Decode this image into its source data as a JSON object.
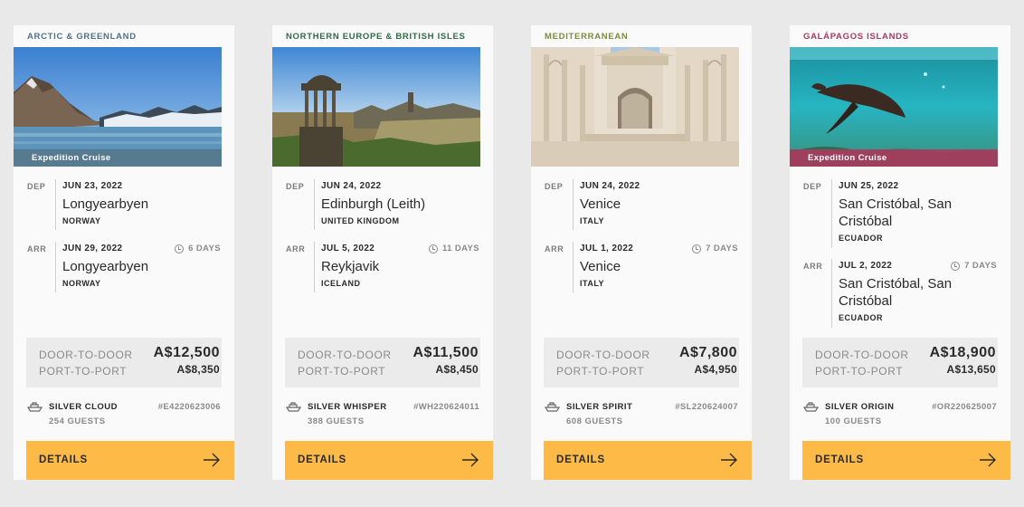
{
  "cards": [
    {
      "region": "ARCTIC & GREENLAND",
      "region_color": "#4f7286",
      "image": "arctic-mountains-fjord",
      "badge": "Expedition Cruise",
      "badge_color": "#4f7286",
      "dep": {
        "code": "DEP",
        "date": "JUN 23, 2022",
        "city": "Longyearbyen",
        "country": "NORWAY"
      },
      "arr": {
        "code": "ARR",
        "date": "JUN 29, 2022",
        "city": "Longyearbyen",
        "country": "NORWAY"
      },
      "duration": "6 DAYS",
      "door_label": "DOOR-TO-DOOR",
      "door_price": "A$12,500",
      "port_label": "PORT-TO-PORT",
      "port_price": "A$8,350",
      "ship_name": "SILVER CLOUD",
      "guests": "254 GUESTS",
      "voyage_code": "#E4220623006",
      "details_label": "DETAILS"
    },
    {
      "region": "NORTHERN EUROPE & BRITISH ISLES",
      "region_color": "#2f6b46",
      "image": "edinburgh-monument-sunset",
      "badge": "",
      "badge_color": "",
      "dep": {
        "code": "DEP",
        "date": "JUN 24, 2022",
        "city": "Edinburgh (Leith)",
        "country": "UNITED KINGDOM"
      },
      "arr": {
        "code": "ARR",
        "date": "JUL 5, 2022",
        "city": "Reykjavik",
        "country": "ICELAND"
      },
      "duration": "11 DAYS",
      "door_label": "DOOR-TO-DOOR",
      "door_price": "A$11,500",
      "port_label": "PORT-TO-PORT",
      "port_price": "A$8,450",
      "ship_name": "SILVER WHISPER",
      "guests": "388 GUESTS",
      "voyage_code": "#WH220624011",
      "details_label": "DETAILS"
    },
    {
      "region": "MEDITERRANEAN",
      "region_color": "#7e8a3c",
      "image": "split-diocletian-palace",
      "badge": "",
      "badge_color": "",
      "dep": {
        "code": "DEP",
        "date": "JUN 24, 2022",
        "city": "Venice",
        "country": "ITALY"
      },
      "arr": {
        "code": "ARR",
        "date": "JUL 1, 2022",
        "city": "Venice",
        "country": "ITALY"
      },
      "duration": "7 DAYS",
      "door_label": "DOOR-TO-DOOR",
      "door_price": "A$7,800",
      "port_label": "PORT-TO-PORT",
      "port_price": "A$4,950",
      "ship_name": "SILVER SPIRIT",
      "guests": "608 GUESTS",
      "voyage_code": "#SL220624007",
      "details_label": "DETAILS"
    },
    {
      "region": "GALÁPAGOS ISLANDS",
      "region_color": "#a83a5e",
      "image": "sea-lion-underwater",
      "badge": "Expedition Cruise",
      "badge_color": "#a83a5e",
      "dep": {
        "code": "DEP",
        "date": "JUN 25, 2022",
        "city": "San Cristóbal, San Cristóbal",
        "country": "ECUADOR"
      },
      "arr": {
        "code": "ARR",
        "date": "JUL 2, 2022",
        "city": "San Cristóbal, San Cristóbal",
        "country": "ECUADOR"
      },
      "duration": "7 DAYS",
      "door_label": "DOOR-TO-DOOR",
      "door_price": "A$18,900",
      "port_label": "PORT-TO-PORT",
      "port_price": "A$13,650",
      "ship_name": "SILVER ORIGIN",
      "guests": "100 GUESTS",
      "voyage_code": "#OR220625007",
      "details_label": "DETAILS"
    }
  ]
}
